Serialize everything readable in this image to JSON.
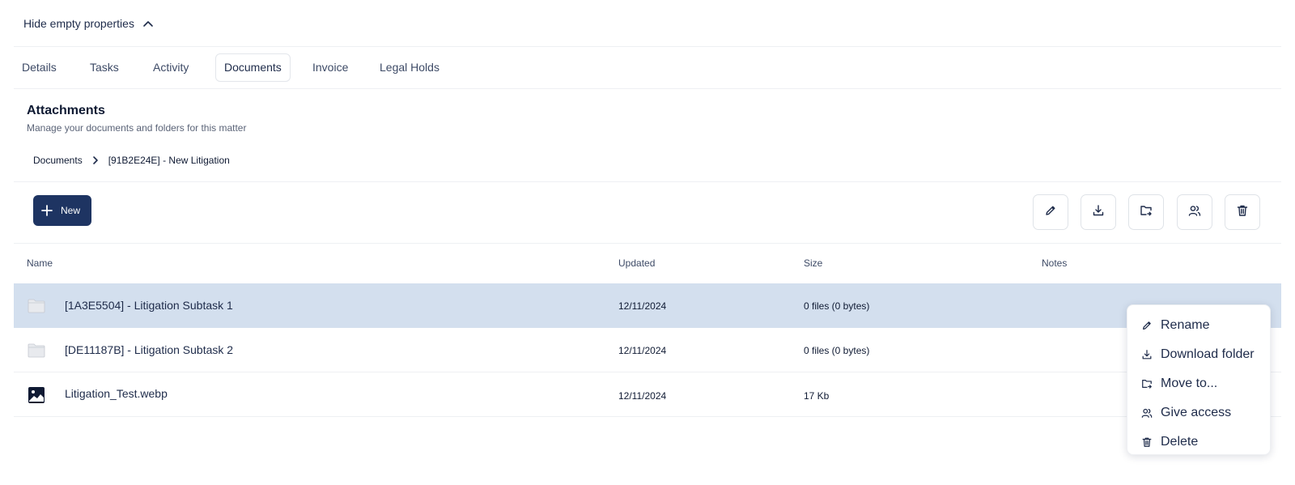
{
  "toggle": {
    "label": "Hide empty properties"
  },
  "tabs": [
    {
      "label": "Details",
      "active": false
    },
    {
      "label": "Tasks",
      "active": false
    },
    {
      "label": "Activity",
      "active": false
    },
    {
      "label": "Documents",
      "active": true
    },
    {
      "label": "Invoice",
      "active": false
    },
    {
      "label": "Legal Holds",
      "active": false
    }
  ],
  "section": {
    "title": "Attachments",
    "subtitle": "Manage your documents and folders for this matter"
  },
  "breadcrumb": {
    "root": "Documents",
    "current": "[91B2E24E] - New Litigation"
  },
  "toolbar": {
    "new_label": "New",
    "icons": [
      "pencil-icon",
      "download-icon",
      "folder-move-icon",
      "users-icon",
      "trash-icon"
    ]
  },
  "table": {
    "columns": {
      "name": "Name",
      "updated": "Updated",
      "size": "Size",
      "notes": "Notes"
    },
    "rows": [
      {
        "type": "folder",
        "icon": "folder-icon",
        "name": "[1A3E5504] - Litigation Subtask 1",
        "updated": "12/11/2024",
        "size": "0 files (0 bytes)",
        "selected": true
      },
      {
        "type": "folder",
        "icon": "folder-icon",
        "name": "[DE11187B] - Litigation Subtask 2",
        "updated": "12/11/2024",
        "size": "0 files (0 bytes)",
        "selected": false
      },
      {
        "type": "image",
        "icon": "image-file-icon",
        "name": "Litigation_Test.webp",
        "updated": "12/11/2024",
        "size": "17 Kb",
        "selected": false
      }
    ]
  },
  "context_menu": {
    "items": [
      {
        "label": "Rename",
        "icon": "pencil-icon"
      },
      {
        "label": "Download folder",
        "icon": "download-icon"
      },
      {
        "label": "Move to...",
        "icon": "folder-move-icon"
      },
      {
        "label": "Give access",
        "icon": "users-icon"
      },
      {
        "label": "Delete",
        "icon": "trash-icon"
      }
    ]
  },
  "colors": {
    "primary": "#1e3462",
    "selected_row": "#d3dfee",
    "text": "#1e2b4a"
  }
}
